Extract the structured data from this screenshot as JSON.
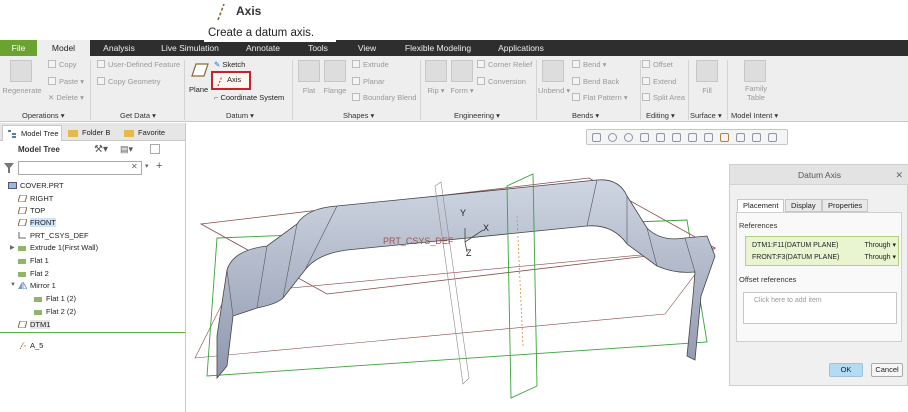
{
  "tooltip": {
    "title": "Axis",
    "description": "Create a datum axis."
  },
  "tabs": [
    "File",
    "Model",
    "Analysis",
    "Live Simulation",
    "Annotate",
    "Tools",
    "View",
    "Flexible Modeling",
    "Applications"
  ],
  "ribbon": {
    "operations": {
      "regenerate": "Regenerate",
      "copy": "Copy",
      "paste": "Paste",
      "delete": "Delete",
      "group": "Operations"
    },
    "get_data": {
      "udf": "User-Defined Feature",
      "copy_geometry": "Copy Geometry",
      "group": "Get Data"
    },
    "datum": {
      "plane": "Plane",
      "sketch": "Sketch",
      "axis": "Axis",
      "csys": "Coordinate System",
      "group": "Datum"
    },
    "shapes": {
      "flat": "Flat",
      "flange": "Flange",
      "extrude": "Extrude",
      "planar": "Planar",
      "boundary_blend": "Boundary Blend",
      "group": "Shapes"
    },
    "engineering": {
      "rip": "Rip",
      "form": "Form",
      "corner_relief": "Corner Relief",
      "conversion": "Conversion",
      "group": "Engineering"
    },
    "bends": {
      "unbend": "Unbend",
      "bend": "Bend",
      "bend_back": "Bend Back",
      "flat_pattern": "Flat Pattern",
      "group": "Bends"
    },
    "editing": {
      "offset": "Offset",
      "extend": "Extend",
      "split_area": "Split Area",
      "group": "Editing"
    },
    "surface": {
      "fill": "Fill",
      "group": "Surface"
    },
    "model_intent": {
      "family_table": "Family\nTable",
      "group": "Model Intent"
    }
  },
  "left_tabs": {
    "model_tree": "Model Tree",
    "folder_browser": "Folder B",
    "favorites": "Favorite"
  },
  "model_tree": {
    "title": "Model Tree",
    "items": [
      "COVER.PRT",
      "RIGHT",
      "TOP",
      "FRONT",
      "PRT_CSYS_DEF",
      "Extrude 1(First Wall)",
      "Flat 1",
      "Flat 2",
      "Mirror 1",
      "Flat 1 (2)",
      "Flat 2 (2)",
      "DTM1",
      "A_5"
    ]
  },
  "graphics": {
    "csys_label": "PRT_CSYS_DEF",
    "x": "X",
    "y": "Y",
    "z": "Z"
  },
  "dialog": {
    "title": "Datum Axis",
    "tabs": [
      "Placement",
      "Display",
      "Properties"
    ],
    "references_label": "References",
    "references": [
      {
        "ref": "DTM1:F11(DATUM PLANE)",
        "constraint": "Through"
      },
      {
        "ref": "FRONT:F3(DATUM PLANE)",
        "constraint": "Through"
      }
    ],
    "offset_label": "Offset references",
    "offset_placeholder": "Click here to add item",
    "ok": "OK",
    "cancel": "Cancel"
  },
  "colors": {
    "file_tab": "#6aa32f",
    "axis_highlight": "#c0252b",
    "ref_bg": "#e9f4d0",
    "ok_bg": "#b3dbf4"
  }
}
